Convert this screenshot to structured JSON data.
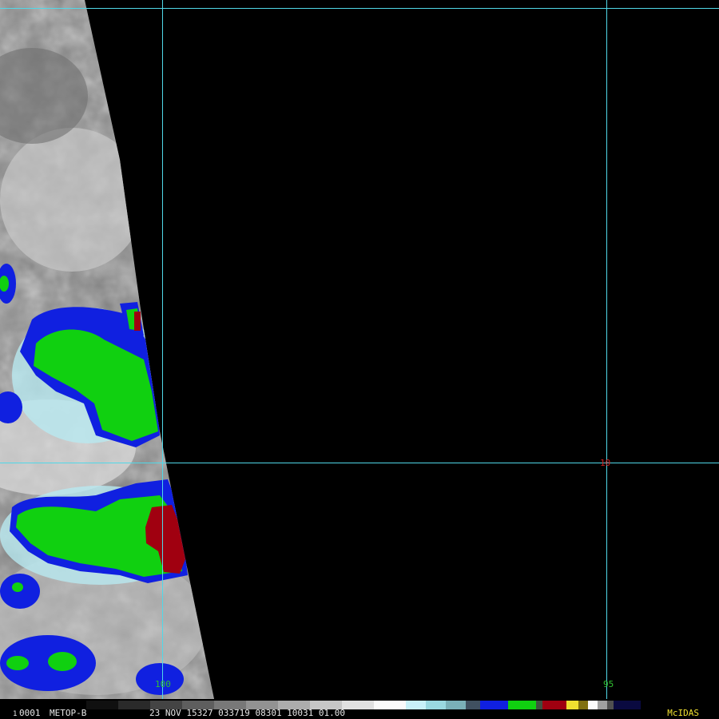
{
  "image": {
    "satellite": "METOP-B",
    "frame_id": "1",
    "frame_number": "0001",
    "date_time_line": "23 NOV 15327 033719 08301 10031 01.00",
    "brand": "McIDAS"
  },
  "grid": {
    "lat_label": "10",
    "lon_labels": [
      "100",
      "95"
    ]
  },
  "colors": {
    "background": "#000000",
    "gridline": "#50d8e8",
    "lat_label": "#d02020",
    "lon_label": "#30c030",
    "enhancement_blue": "#1020e0",
    "enhancement_green": "#10d010",
    "enhancement_red": "#a00010",
    "brand": "#f0e030"
  }
}
